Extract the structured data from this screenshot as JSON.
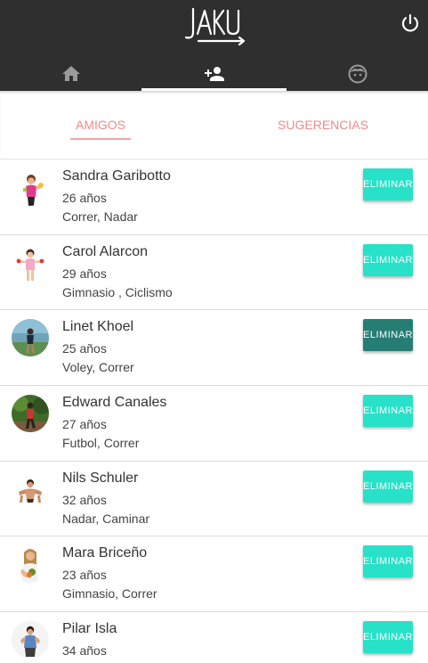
{
  "app": {
    "logo_text": "JAKU",
    "power_icon": "power-icon"
  },
  "nav_tabs": [
    {
      "icon": "home-icon",
      "active": false
    },
    {
      "icon": "add-person-icon",
      "active": true
    },
    {
      "icon": "face-icon",
      "active": false
    }
  ],
  "sub_tabs": [
    {
      "label": "AMIGOS",
      "active": true
    },
    {
      "label": "SUGERENCIAS",
      "active": false
    }
  ],
  "friends": [
    {
      "name": "Sandra Garibotto",
      "age": "26 años",
      "sports": "Correr, Nadar",
      "action": "ELIMINAR"
    },
    {
      "name": "Carol Alarcon",
      "age": "29 años",
      "sports": "Gimnasio , Ciclismo",
      "action": "ELIMINAR"
    },
    {
      "name": "Linet Khoel",
      "age": "25 años",
      "sports": "Voley, Correr",
      "action": "ELIMINAR",
      "pressed": true
    },
    {
      "name": "Edward Canales",
      "age": "27 años",
      "sports": "Futbol, Correr",
      "action": "ELIMINAR"
    },
    {
      "name": "Nils Schuler",
      "age": "32 años",
      "sports": "Nadar, Caminar",
      "action": "ELIMINAR"
    },
    {
      "name": "Mara Briceño",
      "age": "23 años",
      "sports": "Gimnasio, Correr",
      "action": "ELIMINAR"
    },
    {
      "name": "Pilar Isla",
      "age": "34 años",
      "sports": "",
      "action": "ELIMINAR"
    }
  ],
  "colors": {
    "topbar": "#2f2f2f",
    "accent_pink": "#f08a8a",
    "button_teal": "#27e2c8",
    "button_pressed": "#267d74"
  }
}
